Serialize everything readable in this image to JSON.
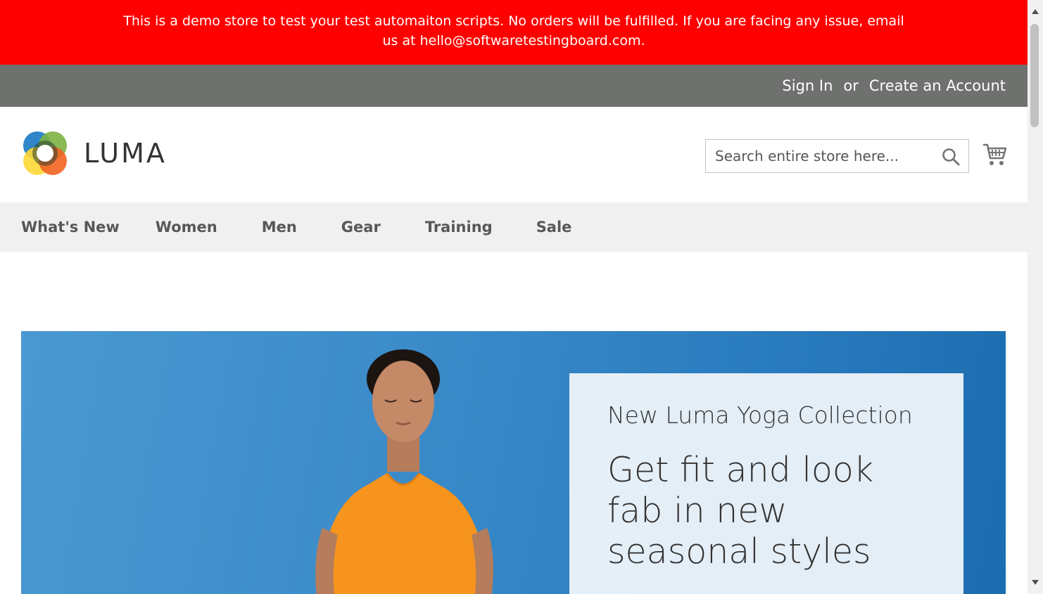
{
  "demo_notice": {
    "text": "This is a demo store to test your test automaiton scripts. No orders will be fulfilled. If you are facing any issue, email us at hello@softwaretestingboard.com."
  },
  "header_links": {
    "sign_in": "Sign In",
    "or": "or",
    "create_account": "Create an Account"
  },
  "logo": {
    "text": "LUMA"
  },
  "search": {
    "placeholder": "Search entire store here..."
  },
  "nav": {
    "items": [
      "What's New",
      "Women",
      "Men",
      "Gear",
      "Training",
      "Sale"
    ]
  },
  "hero": {
    "kicker": "New Luma Yoga Collection",
    "headline": "Get fit and look fab in new seasonal styles"
  },
  "icons": {
    "search": "search-icon",
    "cart": "cart-icon",
    "scroll_up": "scroll-up-icon",
    "scroll_down": "scroll-down-icon"
  },
  "colors": {
    "demo_banner": "#ff0000",
    "header_bar": "#6e716e",
    "nav_bar": "#f0f0f0",
    "hero_sky": "#2a7dbf"
  }
}
